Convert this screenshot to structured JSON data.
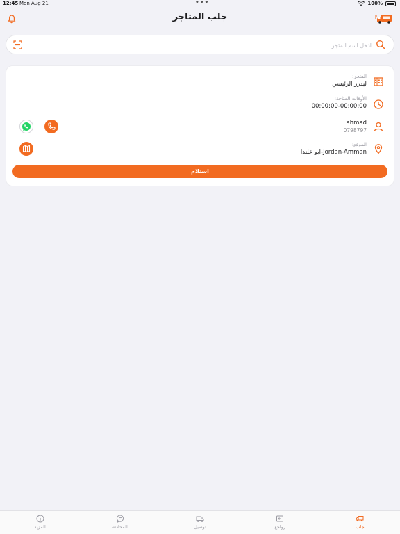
{
  "status_bar": {
    "time": "12:45",
    "date": "Mon Aug 21",
    "dots": "•••",
    "battery": "100%"
  },
  "header": {
    "title": "جلب المتاجر"
  },
  "search": {
    "placeholder": "ادخل اسم المتجر"
  },
  "store_card": {
    "store_label": "المتجر:",
    "store_name": "ليدرز الرئيسي",
    "times_label": "الأوقات المتاحة:",
    "times_value": "00:00:00-00:00:00",
    "contact_name": "ahmad",
    "contact_phone": "0798797",
    "location_label": "الموقع:",
    "location_value": "Jordan-Amman-ابو علندا",
    "receive_button": "استلام"
  },
  "tabbar": {
    "items": [
      {
        "label": "المزيد",
        "icon": "info-icon",
        "active": false
      },
      {
        "label": "المحادثة",
        "icon": "chat-icon",
        "active": false
      },
      {
        "label": "توصيل",
        "icon": "delivery-truck-icon",
        "active": false
      },
      {
        "label": "رواجع",
        "icon": "returns-icon",
        "active": false
      },
      {
        "label": "جلب",
        "icon": "pickup-icon",
        "active": true
      }
    ]
  },
  "colors": {
    "accent": "#f26b21",
    "whatsapp": "#25d366",
    "background": "#f2f2f7"
  }
}
